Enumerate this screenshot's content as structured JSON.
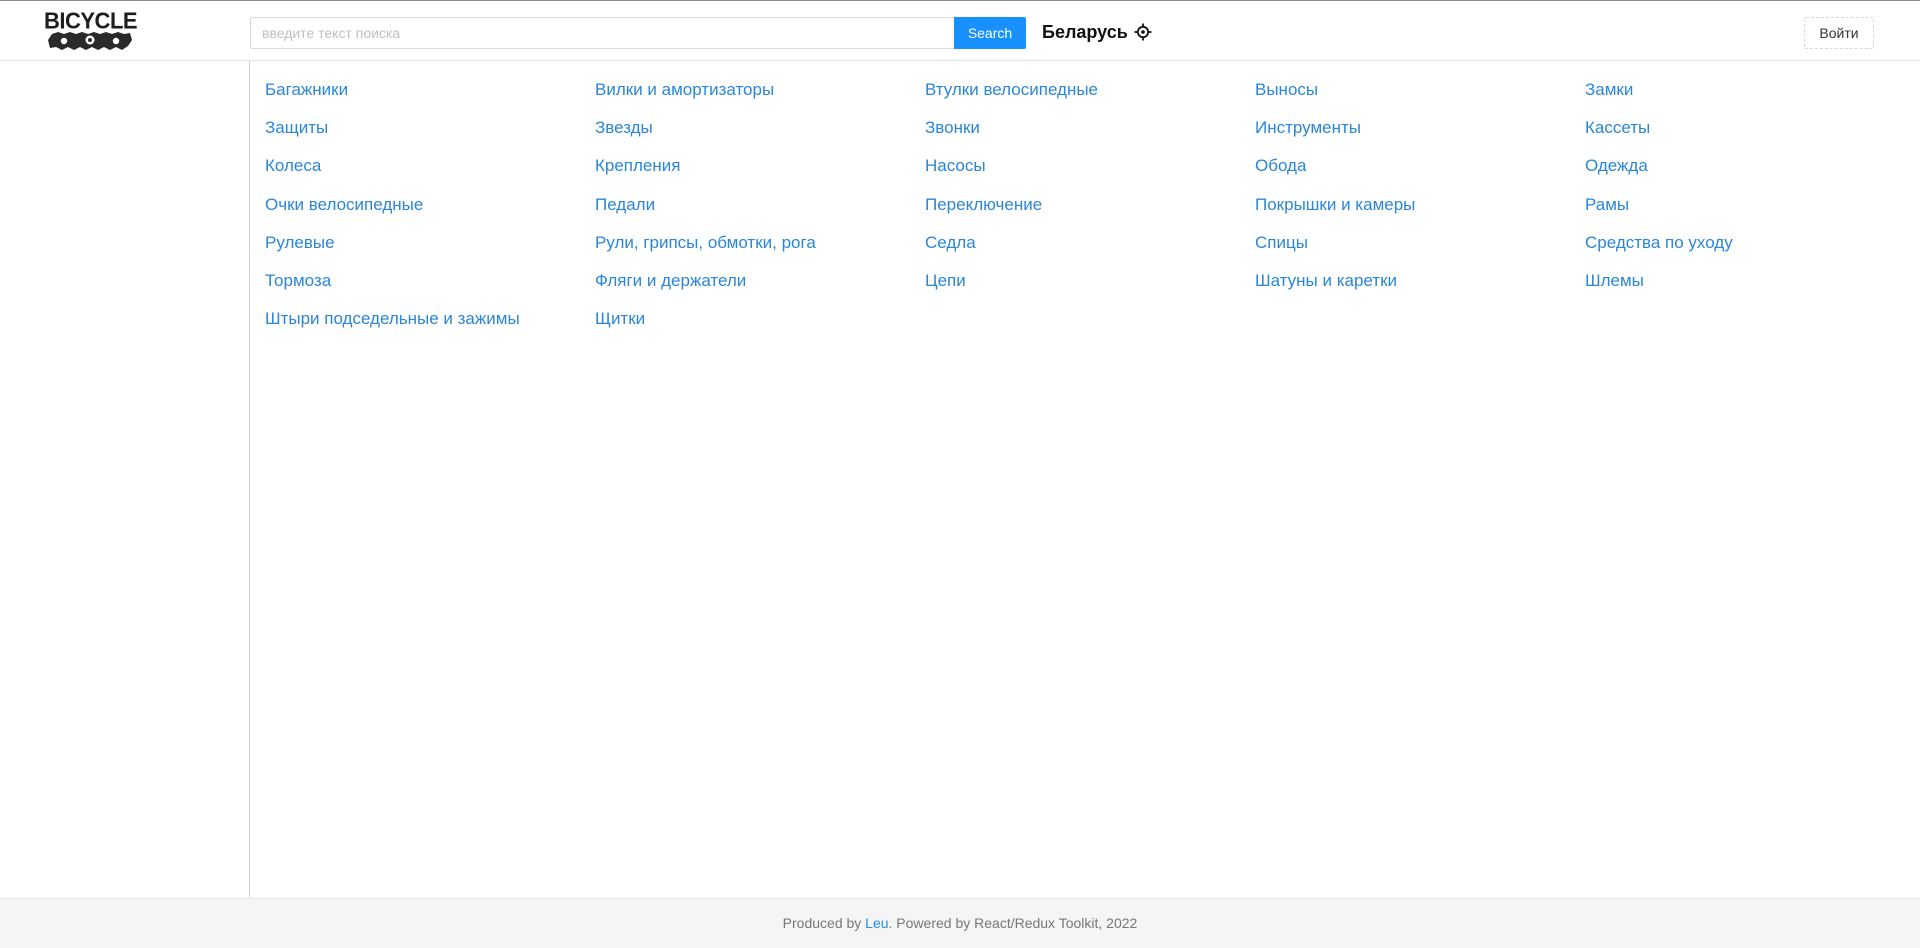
{
  "header": {
    "logo_text": "BICYCLE",
    "search": {
      "placeholder": "введите текст поиска",
      "value": "",
      "button_label": "Search"
    },
    "location": {
      "label": "Беларусь",
      "icon": "crosshair-icon"
    },
    "login_label": "Войти"
  },
  "categories": [
    "Багажники",
    "Вилки и амортизаторы",
    "Втулки велосипедные",
    "Выносы",
    "Замки",
    "Защиты",
    "Звезды",
    "Звонки",
    "Инструменты",
    "Кассеты",
    "Колеса",
    "Крепления",
    "Насосы",
    "Обода",
    "Одежда",
    "Очки велосипедные",
    "Педали",
    "Переключение",
    "Покрышки и камеры",
    "Рамы",
    "Рулевые",
    "Рули, грипсы, обмотки, рога",
    "Седла",
    "Спицы",
    "Средства по уходу",
    "Тормоза",
    "Фляги и держатели",
    "Цепи",
    "Шатуны и каретки",
    "Шлемы",
    "Штыри подседельные и зажимы",
    "Щитки"
  ],
  "footer": {
    "prefix": "Produced by ",
    "author": "Leu",
    "suffix": ". Powered by React/Redux Toolkit, 2022"
  },
  "colors": {
    "accent": "#1890ff",
    "link": "#2a86d8",
    "footer_bg": "#f5f5f5"
  }
}
